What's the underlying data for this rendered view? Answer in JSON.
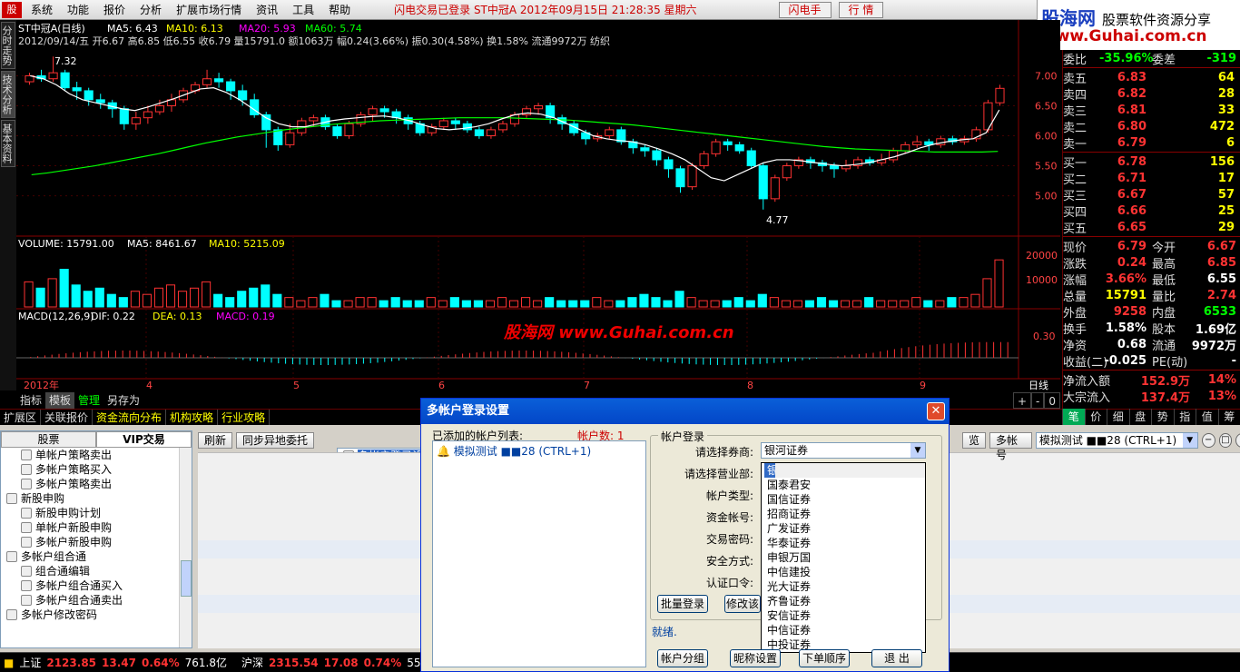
{
  "menu": {
    "logo": "股",
    "items": [
      "系统",
      "功能",
      "报价",
      "分析",
      "扩展市场行情",
      "资讯",
      "工具",
      "帮助"
    ],
    "status": "闪电交易已登录   ST中冠A 2012年09月15日 21:28:35 星期六",
    "btn_flash": "闪电手",
    "btn_quote": "行 情"
  },
  "brand": {
    "name": "股海网",
    "slogan": "股票软件资源分享",
    "url": "www.Guhai.com.cn"
  },
  "sidetabs": [
    "分时走势",
    "技术分析",
    "基本资料"
  ],
  "chart": {
    "title_line": "ST中冠A(日线)",
    "ma_labels": [
      {
        "t": "MA5: 6.43",
        "c": "#ffffff"
      },
      {
        "t": "MA10: 6.13",
        "c": "#ffff00"
      },
      {
        "t": "MA20: 5.93",
        "c": "#ff00ff"
      },
      {
        "t": "MA60: 5.74",
        "c": "#00ff00"
      }
    ],
    "info_line": "2012/09/14/五 开6.67 高6.85 低6.55 收6.79 量15791.0 额1063万 幅0.24(3.66%) 振0.30(4.58%) 换1.58% 流通9972万 纺织",
    "max_label": "7.32",
    "min_label": "4.77",
    "price_ticks": [
      "7.00",
      "6.50",
      "6.00",
      "5.50",
      "5.00"
    ],
    "volume_line": "VOLUME: 15791.00",
    "vol_ma5": "MA5: 8461.67",
    "vol_ma10": "MA10: 5215.09",
    "vol_ticks": [
      "20000",
      "10000"
    ],
    "macd_line": "MACD(12,26,9)",
    "dif": "DIF: 0.22",
    "dea": "DEA: 0.13",
    "macd": "MACD: 0.19",
    "macd_tick": "0.30",
    "date_labels": [
      "2012年",
      "4",
      "5",
      "6",
      "7",
      "8",
      "9"
    ],
    "period": "日线",
    "zoom": [
      "+",
      "-",
      "0"
    ],
    "watermark": "股海网 www.Guhai.com.cn"
  },
  "chart_data": {
    "type": "candlestick",
    "ylim": [
      4.6,
      7.4
    ],
    "candles": [
      [
        6.9,
        7.0,
        6.85,
        7.05
      ],
      [
        7.0,
        6.95,
        6.9,
        7.1
      ],
      [
        6.95,
        7.05,
        6.9,
        7.32
      ],
      [
        7.05,
        6.8,
        6.75,
        7.1
      ],
      [
        6.8,
        6.75,
        6.6,
        6.9
      ],
      [
        6.75,
        6.6,
        6.5,
        6.8
      ],
      [
        6.6,
        6.55,
        6.45,
        6.7
      ],
      [
        6.55,
        6.45,
        6.3,
        6.6
      ],
      [
        6.45,
        6.2,
        6.1,
        6.5
      ],
      [
        6.2,
        6.3,
        6.1,
        6.4
      ],
      [
        6.3,
        6.4,
        6.2,
        6.5
      ],
      [
        6.4,
        6.5,
        6.35,
        6.6
      ],
      [
        6.5,
        6.6,
        6.4,
        6.7
      ],
      [
        6.6,
        6.75,
        6.55,
        6.8
      ],
      [
        6.75,
        6.85,
        6.7,
        6.9
      ],
      [
        6.85,
        6.95,
        6.8,
        7.1
      ],
      [
        6.95,
        6.9,
        6.8,
        7.05
      ],
      [
        6.9,
        6.75,
        6.6,
        6.95
      ],
      [
        6.75,
        6.6,
        6.5,
        6.85
      ],
      [
        6.6,
        6.35,
        6.3,
        6.7
      ],
      [
        6.35,
        6.1,
        5.8,
        6.4
      ],
      [
        6.1,
        5.85,
        5.75,
        6.15
      ],
      [
        5.85,
        6.05,
        5.8,
        6.2
      ],
      [
        6.05,
        6.25,
        6.0,
        6.3
      ],
      [
        6.25,
        6.3,
        6.15,
        6.35
      ],
      [
        6.3,
        6.15,
        6.1,
        6.35
      ],
      [
        6.15,
        6.0,
        5.95,
        6.2
      ],
      [
        6.0,
        6.2,
        5.95,
        6.25
      ],
      [
        6.2,
        6.35,
        6.15,
        6.4
      ],
      [
        6.35,
        6.45,
        6.25,
        6.5
      ],
      [
        6.45,
        6.4,
        6.3,
        6.5
      ],
      [
        6.4,
        6.3,
        6.2,
        6.45
      ],
      [
        6.3,
        6.2,
        6.1,
        6.35
      ],
      [
        6.2,
        6.05,
        6.0,
        6.25
      ],
      [
        6.05,
        6.15,
        6.0,
        6.2
      ],
      [
        6.15,
        6.25,
        6.1,
        6.3
      ],
      [
        6.25,
        6.2,
        6.1,
        6.3
      ],
      [
        6.2,
        6.1,
        6.05,
        6.25
      ],
      [
        6.1,
        6.0,
        5.95,
        6.15
      ],
      [
        6.0,
        6.1,
        5.95,
        6.15
      ],
      [
        6.1,
        6.2,
        6.05,
        6.25
      ],
      [
        6.2,
        6.35,
        6.15,
        6.4
      ],
      [
        6.35,
        6.45,
        6.3,
        6.5
      ],
      [
        6.45,
        6.5,
        6.35,
        6.55
      ],
      [
        6.5,
        6.3,
        6.2,
        6.55
      ],
      [
        6.3,
        6.2,
        6.1,
        6.35
      ],
      [
        6.2,
        6.05,
        6.0,
        6.25
      ],
      [
        6.05,
        5.95,
        5.85,
        6.1
      ],
      [
        5.95,
        6.0,
        5.9,
        6.05
      ],
      [
        6.0,
        6.1,
        5.95,
        6.15
      ],
      [
        6.1,
        5.9,
        5.85,
        6.15
      ],
      [
        5.9,
        5.8,
        5.7,
        5.95
      ],
      [
        5.8,
        5.75,
        5.65,
        5.85
      ],
      [
        5.75,
        5.6,
        5.5,
        5.8
      ],
      [
        5.6,
        5.45,
        5.3,
        5.65
      ],
      [
        5.45,
        5.15,
        5.05,
        5.5
      ],
      [
        5.15,
        5.5,
        5.1,
        5.55
      ],
      [
        5.5,
        5.7,
        5.45,
        5.75
      ],
      [
        5.7,
        5.9,
        5.65,
        5.95
      ],
      [
        5.9,
        5.85,
        5.75,
        5.95
      ],
      [
        5.85,
        5.75,
        5.7,
        5.9
      ],
      [
        5.75,
        5.5,
        5.45,
        5.8
      ],
      [
        5.5,
        4.95,
        4.77,
        5.55
      ],
      [
        4.95,
        5.3,
        4.9,
        5.35
      ],
      [
        5.3,
        5.5,
        5.25,
        5.55
      ],
      [
        5.5,
        5.6,
        5.45,
        5.65
      ],
      [
        5.6,
        5.55,
        5.45,
        5.65
      ],
      [
        5.55,
        5.5,
        5.4,
        5.6
      ],
      [
        5.5,
        5.45,
        5.3,
        5.55
      ],
      [
        5.45,
        5.5,
        5.4,
        5.6
      ],
      [
        5.5,
        5.6,
        5.45,
        5.65
      ],
      [
        5.6,
        5.55,
        5.5,
        5.65
      ],
      [
        5.55,
        5.6,
        5.5,
        5.7
      ],
      [
        5.6,
        5.75,
        5.55,
        5.8
      ],
      [
        5.75,
        5.85,
        5.7,
        5.9
      ],
      [
        5.85,
        5.9,
        5.8,
        6.0
      ],
      [
        5.9,
        5.85,
        5.75,
        5.95
      ],
      [
        5.85,
        5.95,
        5.8,
        6.0
      ],
      [
        5.95,
        5.9,
        5.85,
        6.0
      ],
      [
        5.9,
        5.95,
        5.85,
        6.0
      ],
      [
        5.95,
        6.1,
        5.9,
        6.15
      ],
      [
        6.1,
        6.55,
        6.05,
        6.6
      ],
      [
        6.55,
        6.79,
        6.5,
        6.85
      ]
    ],
    "ma5": [
      7.0,
      6.95,
      6.85,
      6.7,
      6.6,
      6.55,
      6.5,
      6.45,
      6.42,
      6.48,
      6.55,
      6.62,
      6.7,
      6.78,
      6.8,
      6.72,
      6.6,
      6.45,
      6.3,
      6.2,
      6.15,
      6.15,
      6.2,
      6.25,
      6.28,
      6.3,
      6.32,
      6.33,
      6.3,
      6.25,
      6.18,
      6.12,
      6.1,
      6.12,
      6.15,
      6.2,
      6.28,
      6.35,
      6.38,
      6.36,
      6.3,
      6.2,
      6.1,
      6.0,
      5.95,
      5.92,
      5.9,
      5.85,
      5.78,
      5.7,
      5.6,
      5.45,
      5.3,
      5.25,
      5.35,
      5.45,
      5.55,
      5.6,
      5.6,
      5.58,
      5.55,
      5.52,
      5.5,
      5.52,
      5.55,
      5.6,
      5.65,
      5.72,
      5.8,
      5.86,
      5.9,
      5.93,
      5.95,
      6.05,
      6.43
    ],
    "ma60": [
      5.35,
      5.38,
      5.42,
      5.46,
      5.5,
      5.55,
      5.6,
      5.65,
      5.7,
      5.76,
      5.82,
      5.88,
      5.93,
      5.98,
      6.02,
      6.06,
      6.1,
      6.13,
      6.16,
      6.19,
      6.21,
      6.23,
      6.25,
      6.26,
      6.27,
      6.28,
      6.29,
      6.3,
      6.3,
      6.3,
      6.3,
      6.29,
      6.28,
      6.27,
      6.26,
      6.24,
      6.22,
      6.2,
      6.18,
      6.15,
      6.12,
      6.09,
      6.06,
      6.03,
      6.0,
      5.97,
      5.94,
      5.91,
      5.88,
      5.85,
      5.82,
      5.8,
      5.78,
      5.77,
      5.76,
      5.75,
      5.74,
      5.73,
      5.73,
      5.73,
      5.73,
      5.74
    ],
    "volume": [
      8,
      6,
      9,
      12,
      7,
      5,
      6,
      4,
      3,
      5,
      4,
      6,
      7,
      5,
      6,
      8,
      4,
      3,
      5,
      6,
      7,
      4,
      3,
      2,
      3,
      4,
      2,
      2,
      3,
      3,
      2,
      3,
      2,
      2,
      3,
      2,
      3,
      2,
      2,
      2,
      3,
      2,
      3,
      2,
      3,
      2,
      2,
      2,
      3,
      2,
      2,
      3,
      4,
      3,
      2,
      5,
      3,
      2,
      2,
      2,
      3,
      2,
      4,
      3,
      2,
      2,
      2,
      3,
      2,
      2,
      2,
      3,
      2,
      2,
      2,
      3,
      2,
      2,
      3,
      3,
      4,
      9,
      15
    ]
  },
  "right": {
    "weibi_l": "委比",
    "weibi_v": "-35.96%",
    "weicha_l": "委差",
    "weicha_v": "-319",
    "sells": [
      {
        "l": "卖五",
        "p": "6.83",
        "v": "64"
      },
      {
        "l": "卖四",
        "p": "6.82",
        "v": "28"
      },
      {
        "l": "卖三",
        "p": "6.81",
        "v": "33"
      },
      {
        "l": "卖二",
        "p": "6.80",
        "v": "472"
      },
      {
        "l": "卖一",
        "p": "6.79",
        "v": "6"
      }
    ],
    "buys": [
      {
        "l": "买一",
        "p": "6.78",
        "v": "156"
      },
      {
        "l": "买二",
        "p": "6.71",
        "v": "17"
      },
      {
        "l": "买三",
        "p": "6.67",
        "v": "57"
      },
      {
        "l": "买四",
        "p": "6.66",
        "v": "25"
      },
      {
        "l": "买五",
        "p": "6.65",
        "v": "29"
      }
    ],
    "stats": [
      {
        "l1": "现价",
        "v1": "6.79",
        "c1": "#ff3333",
        "l2": "今开",
        "v2": "6.67",
        "c2": "#ff3333"
      },
      {
        "l1": "涨跌",
        "v1": "0.24",
        "c1": "#ff3333",
        "l2": "最高",
        "v2": "6.85",
        "c2": "#ff3333"
      },
      {
        "l1": "涨幅",
        "v1": "3.66%",
        "c1": "#ff3333",
        "l2": "最低",
        "v2": "6.55",
        "c2": "#ffffff"
      },
      {
        "l1": "总量",
        "v1": "15791",
        "c1": "#ffff00",
        "l2": "量比",
        "v2": "2.74",
        "c2": "#ff3333"
      },
      {
        "l1": "外盘",
        "v1": "9258",
        "c1": "#ff3333",
        "l2": "内盘",
        "v2": "6533",
        "c2": "#00ff00"
      },
      {
        "l1": "换手",
        "v1": "1.58%",
        "c1": "#ffffff",
        "l2": "股本",
        "v2": "1.69亿",
        "c2": "#ffffff"
      },
      {
        "l1": "净资",
        "v1": "0.68",
        "c1": "#ffffff",
        "l2": "流通",
        "v2": "9972万",
        "c2": "#ffffff"
      },
      {
        "l1": "收益(二)",
        "v1": "-0.025",
        "c1": "#ffffff",
        "l2": "PE(动)",
        "v2": "-",
        "c2": "#ffffff"
      }
    ],
    "flow_l": "净流入额",
    "flow_v": "152.9万",
    "flow_p": "14%",
    "flow2_l": "大宗流入",
    "flow2_v": "137.4万",
    "flow2_p": "13%"
  },
  "bottomtabs": [
    "指标",
    "模板",
    "管理",
    "另存为"
  ],
  "extbar": [
    "扩展区",
    "关联报价",
    "资金流向分布",
    "机构攻略",
    "行业攻略"
  ],
  "quicktabs": [
    "笔",
    "价",
    "细",
    "盘",
    "势",
    "指",
    "值",
    "筹"
  ],
  "trade": {
    "tabs": [
      "股票",
      "VIP交易"
    ],
    "tree": [
      {
        "t": "单帐户策略卖出",
        "lv": 2
      },
      {
        "t": "多帐户策略买入",
        "lv": 2
      },
      {
        "t": "多帐户策略卖出",
        "lv": 2
      },
      {
        "t": "新股申购",
        "lv": 1
      },
      {
        "t": "新股申购计划",
        "lv": 2
      },
      {
        "t": "单帐户新股申购",
        "lv": 2
      },
      {
        "t": "多帐户新股申购",
        "lv": 2
      },
      {
        "t": "多帐户组合通",
        "lv": 1
      },
      {
        "t": "组合通编辑",
        "lv": 2
      },
      {
        "t": "多帐户组合通买入",
        "lv": 2
      },
      {
        "t": "多帐户组合通卖出",
        "lv": 2
      },
      {
        "t": "多帐户登录设置",
        "lv": 1,
        "sel": true
      },
      {
        "t": "多帐户修改密码",
        "lv": 1
      }
    ],
    "btn_refresh": "刷新",
    "btn_sync": "同步异地委托",
    "btn_acct_short": "览",
    "btn_multi": "多帐号",
    "acct_combo": "模拟测试 ■■28 (CTRL+1)"
  },
  "dialog": {
    "title": "多帐户登录设置",
    "list_label": "已添加的帐户列表:",
    "count": "帐户数: 1",
    "acct_item": "模拟测试 ■■28 (CTRL+1)",
    "group": "帐户登录",
    "lbl_broker": "请选择券商:",
    "lbl_branch": "请选择营业部:",
    "lbl_type": "帐户类型:",
    "lbl_acct": "资金帐号:",
    "lbl_pwd": "交易密码:",
    "lbl_safe": "安全方式:",
    "lbl_auth": "认证口令:",
    "broker_value": "银河证券",
    "brokers": [
      "银河证券",
      "国泰君安",
      "国信证券",
      "招商证券",
      "广发证券",
      "华泰证券",
      "申银万国",
      "中信建投",
      "光大证券",
      "齐鲁证券",
      "安信证券",
      "中信证券",
      "中投证券"
    ],
    "btn_batch": "批量登录",
    "btn_modify": "修改该",
    "ready": "就绪.",
    "btn_group": "帐户分组",
    "btn_nick": "昵称设置",
    "btn_order": "下单顺序",
    "btn_exit": "退 出"
  },
  "status": {
    "sh_l": "上证",
    "sh_v": "2123.85",
    "sh_c": "13.47",
    "sh_p": "0.64%",
    "sh_amt": "761.8亿",
    "sz_l": "沪深",
    "sz_v": "2315.54",
    "sz_c": "17.08",
    "sz_p": "0.74%",
    "sz_amt": "554.4亿"
  }
}
